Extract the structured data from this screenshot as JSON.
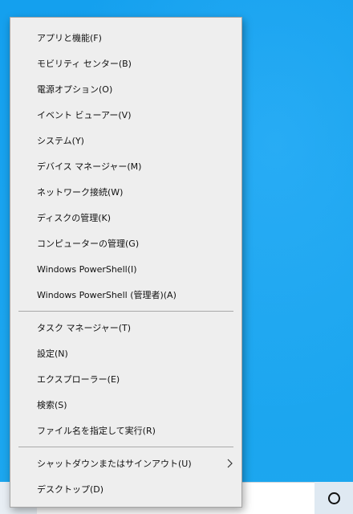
{
  "menu": {
    "group1": [
      {
        "name": "menu-item-apps-features",
        "label": "アプリと機能(F)"
      },
      {
        "name": "menu-item-mobility-center",
        "label": "モビリティ センター(B)"
      },
      {
        "name": "menu-item-power-options",
        "label": "電源オプション(O)"
      },
      {
        "name": "menu-item-event-viewer",
        "label": "イベント ビューアー(V)"
      },
      {
        "name": "menu-item-system",
        "label": "システム(Y)"
      },
      {
        "name": "menu-item-device-manager",
        "label": "デバイス マネージャー(M)"
      },
      {
        "name": "menu-item-network-connections",
        "label": "ネットワーク接続(W)"
      },
      {
        "name": "menu-item-disk-management",
        "label": "ディスクの管理(K)"
      },
      {
        "name": "menu-item-computer-management",
        "label": "コンピューターの管理(G)"
      },
      {
        "name": "menu-item-powershell",
        "label": "Windows PowerShell(I)"
      },
      {
        "name": "menu-item-powershell-admin",
        "label": "Windows PowerShell (管理者)(A)"
      }
    ],
    "group2": [
      {
        "name": "menu-item-task-manager",
        "label": "タスク マネージャー(T)"
      },
      {
        "name": "menu-item-settings",
        "label": "設定(N)"
      },
      {
        "name": "menu-item-explorer",
        "label": "エクスプローラー(E)"
      },
      {
        "name": "menu-item-search",
        "label": "検索(S)"
      },
      {
        "name": "menu-item-run",
        "label": "ファイル名を指定して実行(R)"
      }
    ],
    "group3": [
      {
        "name": "menu-item-shutdown-signout",
        "label": "シャットダウンまたはサインアウト(U)",
        "has_submenu": true
      },
      {
        "name": "menu-item-desktop",
        "label": "デスクトップ(D)"
      }
    ]
  },
  "taskbar": {
    "cortana_icon": "circle-icon"
  },
  "colors": {
    "desktop": "#14a0ee",
    "menu_background": "#eeeeee",
    "menu_border": "#a5a5a5",
    "text": "#111111"
  }
}
